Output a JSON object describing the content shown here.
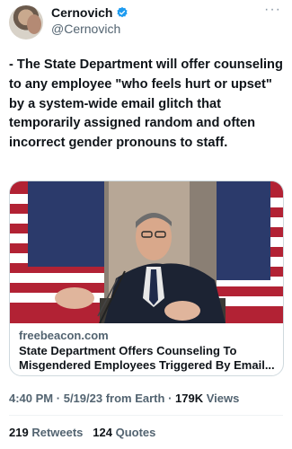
{
  "author": {
    "display_name": "Cernovich",
    "handle": "@Cernovich"
  },
  "tweet": {
    "text": "- The State Department will offer counseling to any employee \"who feels hurt or upset\" by a system-wide email glitch that temporarily assigned random and often incorrect gender pronouns to staff."
  },
  "card": {
    "domain": "freebeacon.com",
    "title": "State Department Offers Counseling To Misgendered Employees Triggered By Email..."
  },
  "meta": {
    "time": "4:40 PM",
    "date": "5/19/23",
    "source": "from Earth",
    "views_count": "179K",
    "views_label": "Views"
  },
  "stats": {
    "retweets_count": "219",
    "retweets_label": "Retweets",
    "quotes_count": "124",
    "quotes_label": "Quotes"
  },
  "colors": {
    "verified": "#1d9bf0",
    "secondary_text": "#536471",
    "border": "#cfd9de"
  },
  "icons": [
    "verified-badge-icon",
    "more-options-icon"
  ]
}
